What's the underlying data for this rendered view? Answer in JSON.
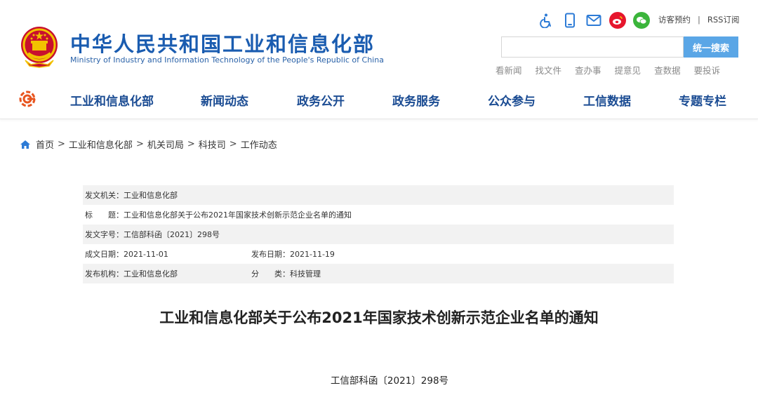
{
  "header": {
    "site_title": "中华人民共和国工业和信息化部",
    "site_subtitle": "Ministry of Industry and Information Technology of the People's Republic of China",
    "tools": {
      "icons": [
        "accessibility-icon",
        "mobile-icon",
        "mail-icon",
        "weibo-icon",
        "wechat-icon"
      ],
      "visitor_booking": "访客预约",
      "separator": "|",
      "rss": "RSS订阅"
    },
    "search": {
      "placeholder": "",
      "button_label": "统一搜索"
    },
    "quick_links": [
      "看新闻",
      "找文件",
      "查办事",
      "提意见",
      "查数据",
      "要投诉"
    ]
  },
  "nav": {
    "items": [
      "工业和信息化部",
      "新闻动态",
      "政务公开",
      "政务服务",
      "公众参与",
      "工信数据",
      "专题专栏"
    ]
  },
  "breadcrumb": {
    "items": [
      "首页",
      "工业和信息化部",
      "机关司局",
      "科技司",
      "工作动态"
    ],
    "separator": ">"
  },
  "meta": {
    "issuer_label": "发文机关：",
    "issuer": "工业和信息化部",
    "title_label": "标　　题：",
    "title": "工业和信息化部关于公布2021年国家技术创新示范企业名单的通知",
    "doc_no_label": "发文字号：",
    "doc_no": "工信部科函〔2021〕298号",
    "created_label": "成文日期：",
    "created": "2021-11-01",
    "published_label": "发布日期：",
    "published": "2021-11-19",
    "org_label": "发布机构：",
    "org": "工业和信息化部",
    "category_label": "分　　类：",
    "category": "科技管理"
  },
  "article": {
    "title": "工业和信息化部关于公布2021年国家技术创新示范企业名单的通知",
    "doc_number": "工信部科函〔2021〕298号"
  },
  "colors": {
    "brand_blue": "#1b4c93",
    "search_button": "#5aa6e6",
    "weibo": "#e6162d",
    "wechat": "#3bb53b",
    "meta_row_bg": "#f2f2f2"
  }
}
